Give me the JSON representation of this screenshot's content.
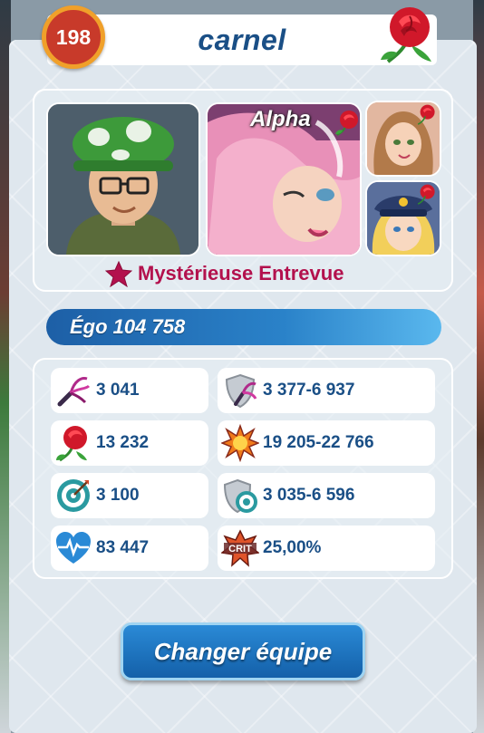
{
  "header": {
    "title": "carnel",
    "level": "198",
    "rose_icon": "rose-icon"
  },
  "team": {
    "hero_icon": "hero-portrait",
    "alpha_label": "Alpha",
    "class_icon": "star-icon",
    "class_label": "Mystérieuse Entrevue"
  },
  "ego": {
    "label": "Égo 104 758"
  },
  "stats": [
    {
      "icon": "whip-icon",
      "value": "3 041"
    },
    {
      "icon": "shield-whip-icon",
      "value": "3 377-6 937"
    },
    {
      "icon": "rose-icon",
      "value": "13 232"
    },
    {
      "icon": "explosion-icon",
      "value": "19 205-22 766"
    },
    {
      "icon": "target-icon",
      "value": "3 100"
    },
    {
      "icon": "shield-target-icon",
      "value": "3 035-6 596"
    },
    {
      "icon": "heart-icon",
      "value": "83 447"
    },
    {
      "icon": "crit-icon",
      "value": "25,00%"
    }
  ],
  "actions": {
    "change_team": "Changer équipe"
  },
  "colors": {
    "title": "#1a4f86",
    "class": "#b3114d",
    "ego_bar": "#2a82c9",
    "button": "#1460a9"
  }
}
